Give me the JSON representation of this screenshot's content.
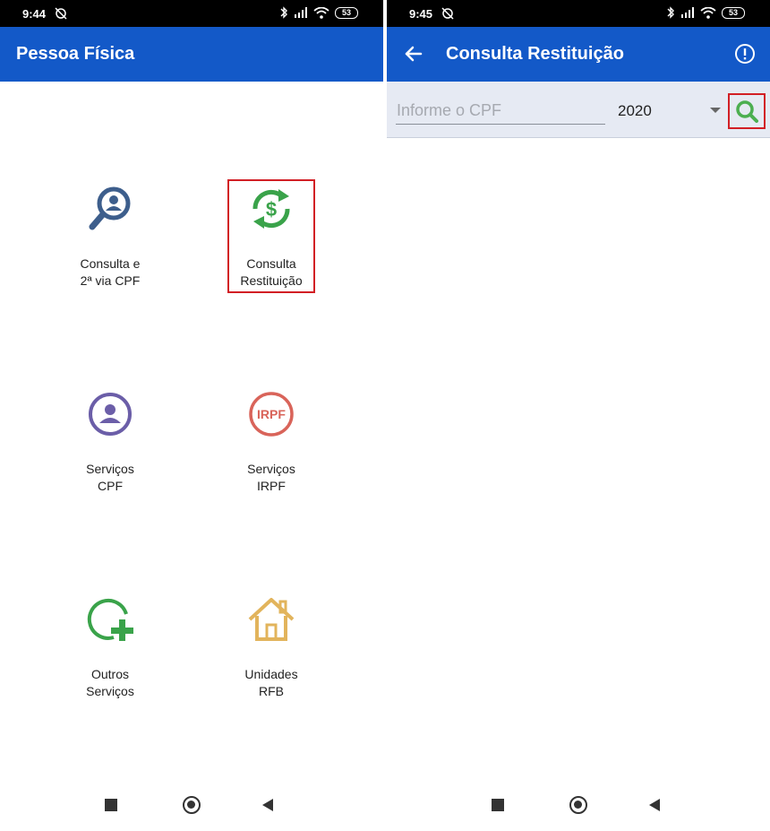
{
  "left": {
    "status": {
      "time": "9:44",
      "battery": "53"
    },
    "title": "Pessoa Física",
    "tiles": [
      {
        "label": "Consulta e\n2ª via CPF",
        "icon": "person-search-icon",
        "color": "#3d5e8c"
      },
      {
        "label": "Consulta\nRestituição",
        "icon": "dollar-refresh-icon",
        "color": "#3aa34a"
      },
      {
        "label": "Serviços\nCPF",
        "icon": "person-circle-icon",
        "color": "#6b5ea8"
      },
      {
        "label": "Serviços\nIRPF",
        "icon": "irpf-badge-icon",
        "color": "#d9645a",
        "badge": "IRPF"
      },
      {
        "label": "Outros\nServiços",
        "icon": "add-circle-icon",
        "color": "#3aa34a"
      },
      {
        "label": "Unidades\nRFB",
        "icon": "house-icon",
        "color": "#e2b45c"
      }
    ]
  },
  "right": {
    "status": {
      "time": "9:45",
      "battery": "53"
    },
    "title": "Consulta Restituição",
    "search": {
      "placeholder": "Informe o CPF",
      "value": "",
      "year": "2020"
    }
  },
  "colors": {
    "appbar": "#1359c8",
    "highlight": "#d21f25",
    "search_icon": "#4caf50",
    "searchbar_bg": "#e6eaf3"
  }
}
